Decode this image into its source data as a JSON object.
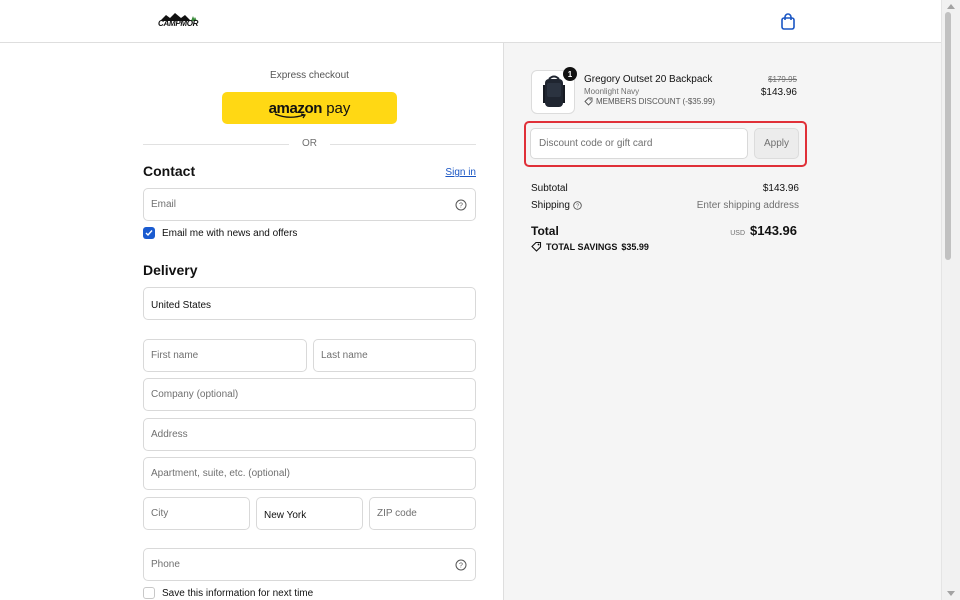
{
  "header": {
    "logo_text": "CAMPMOR",
    "cart_icon": "shopping-bag-icon"
  },
  "express": {
    "label": "Express checkout",
    "amazon_pay_label_bold": "amazon",
    "amazon_pay_label": " pay",
    "or_text": "OR"
  },
  "contact": {
    "title": "Contact",
    "sign_in": "Sign in",
    "email_placeholder": "Email",
    "newsletter_label": "Email me with news and offers",
    "newsletter_checked": true
  },
  "delivery": {
    "title": "Delivery",
    "country": "United States",
    "first_name_placeholder": "First name",
    "last_name_placeholder": "Last name",
    "company_placeholder": "Company (optional)",
    "address_placeholder": "Address",
    "apartment_placeholder": "Apartment, suite, etc. (optional)",
    "city_placeholder": "City",
    "state": "New York",
    "zip_placeholder": "ZIP code",
    "phone_placeholder": "Phone",
    "save_info_label": "Save this information for next time",
    "save_info_checked": false
  },
  "summary": {
    "product": {
      "quantity": "1",
      "name": "Gregory Outset 20 Backpack",
      "variant": "Moonlight Navy",
      "discount": "MEMBERS DISCOUNT (-$35.99)",
      "original_price": "$179.95",
      "price": "$143.96"
    },
    "discount_placeholder": "Discount code or gift card",
    "apply_label": "Apply",
    "subtotal_label": "Subtotal",
    "subtotal_value": "$143.96",
    "shipping_label": "Shipping",
    "shipping_value": "Enter shipping address",
    "total_label": "Total",
    "currency": "USD",
    "total_value": "$143.96",
    "savings_label": "TOTAL SAVINGS",
    "savings_value": "$35.99"
  },
  "colors": {
    "accent": "#1a56c4",
    "amazon_yellow": "#ffd814",
    "highlight": "#e03038"
  }
}
